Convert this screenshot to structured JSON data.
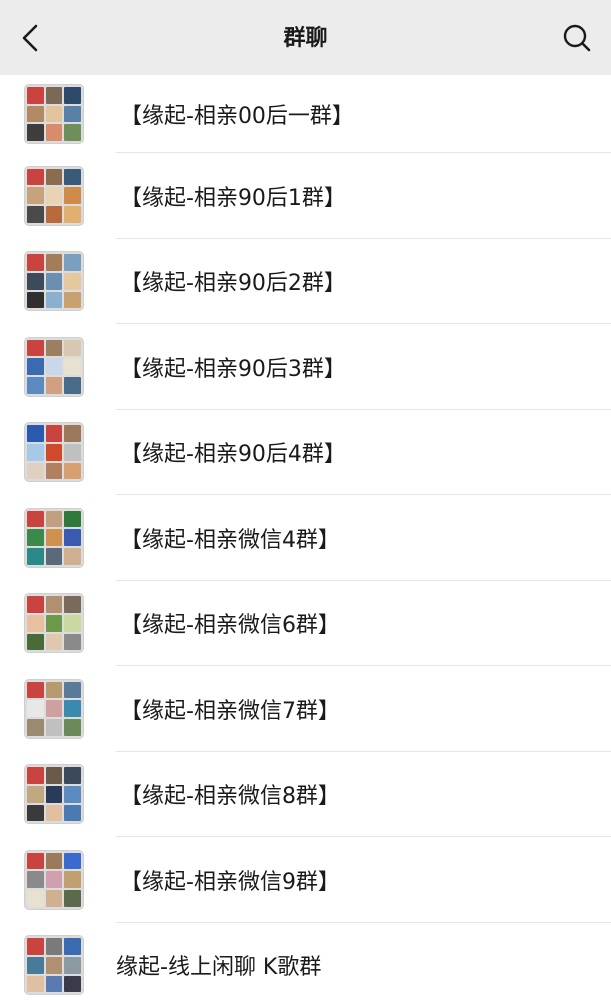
{
  "header": {
    "title": "群聊",
    "back_icon": "chevron-left-icon",
    "search_icon": "search-icon",
    "background": "#ececec"
  },
  "groups": [
    {
      "name": "【缘起-相亲00后一群】",
      "tiles": [
        "#c9443f",
        "#7a6a55",
        "#2e4a6b",
        "#b08a63",
        "#e3c49a",
        "#5a7fa8",
        "#3d3d3d",
        "#d98c6a",
        "#6f8f5a"
      ]
    },
    {
      "name": "【缘起-相亲90后1群】",
      "tiles": [
        "#c9443f",
        "#8a6d4f",
        "#3a5a7a",
        "#c7a27a",
        "#e8d3b5",
        "#d08a4a",
        "#4a4a4a",
        "#b86a3a",
        "#e0b070"
      ]
    },
    {
      "name": "【缘起-相亲90后2群】",
      "tiles": [
        "#c9443f",
        "#a37c5a",
        "#7aa0c0",
        "#3d4a5a",
        "#6a8fb0",
        "#e3c8a0",
        "#2f2f2f",
        "#8ab0d0",
        "#c9a070"
      ]
    },
    {
      "name": "【缘起-相亲90后3群】",
      "tiles": [
        "#c9443f",
        "#9a8060",
        "#d9c8b0",
        "#3a6ab0",
        "#c8d8e8",
        "#e8e0d0",
        "#5a8ac0",
        "#d0a080",
        "#4a6a8a"
      ]
    },
    {
      "name": "【缘起-相亲90后4群】",
      "tiles": [
        "#2a5ab0",
        "#c9443f",
        "#9a7a5a",
        "#a8c8e8",
        "#d04a2a",
        "#c0c0c0",
        "#e0d0c0",
        "#b08060",
        "#d8a070"
      ]
    },
    {
      "name": "【缘起-相亲微信4群】",
      "tiles": [
        "#c9443f",
        "#c0a080",
        "#2f7a3a",
        "#3a8a4a",
        "#d09050",
        "#3a5ab0",
        "#2a8a8a",
        "#5a6a7a",
        "#d0b090"
      ]
    },
    {
      "name": "【缘起-相亲微信6群】",
      "tiles": [
        "#c9443f",
        "#b09070",
        "#7a6a5a",
        "#e8c0a0",
        "#6a9a4a",
        "#c8d8a0",
        "#4a6a3a",
        "#e0c8b0",
        "#8a8a8a"
      ]
    },
    {
      "name": "【缘起-相亲微信7群】",
      "tiles": [
        "#c9443f",
        "#b89a70",
        "#5a7a9a",
        "#e8e8e8",
        "#d0a0a0",
        "#3a8ab0",
        "#9a8a70",
        "#c0c0c0",
        "#6a8a5a"
      ]
    },
    {
      "name": "【缘起-相亲微信8群】",
      "tiles": [
        "#c9443f",
        "#6a5a4a",
        "#3a4a5a",
        "#c0a880",
        "#2a3a5a",
        "#5a8ac0",
        "#3a3a3a",
        "#e0c0a0",
        "#4a7ab0"
      ]
    },
    {
      "name": "【缘起-相亲微信9群】",
      "tiles": [
        "#c9443f",
        "#9a7a5a",
        "#3a6ad0",
        "#8a8a8a",
        "#d0a0b0",
        "#c0a070",
        "#e8e0d0",
        "#d0b090",
        "#5a6a4a"
      ]
    },
    {
      "name": "缘起-线上闲聊 K歌群",
      "tiles": [
        "#c9443f",
        "#7a7a7a",
        "#3a6ab0",
        "#4a7a9a",
        "#b09070",
        "#8a9aa0",
        "#e0c0a0",
        "#5a7ab0",
        "#3a3a4a"
      ]
    }
  ]
}
